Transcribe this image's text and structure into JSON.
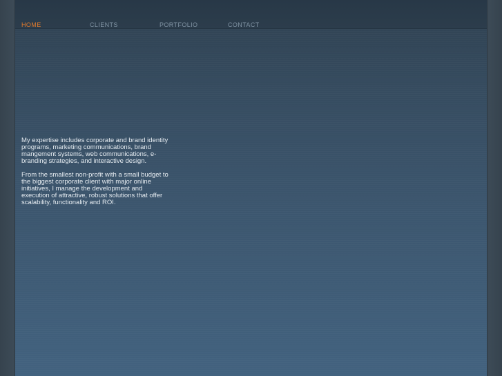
{
  "nav": {
    "items": [
      {
        "label": "HOME",
        "active": true
      },
      {
        "label": "CLIENTS",
        "active": false
      },
      {
        "label": "PORTFOLIO",
        "active": false
      },
      {
        "label": "CONTACT",
        "active": false
      }
    ]
  },
  "content": {
    "paragraph_1": "My expertise includes corporate and brand identity programs, marketing communications, brand mangement systems, web communications, e-branding strategies, and interactive design.",
    "paragraph_2": "From the smallest non-profit with a small budget to the biggest corporate client with major online initiatives, I manage the development and execution of attractive, robust solutions that offer scalability, functionality and ROI."
  },
  "colors": {
    "accent": "#e07a2c",
    "nav_inactive": "#8093a3",
    "body_text": "#e6ecf1",
    "background": "#3c566e"
  }
}
